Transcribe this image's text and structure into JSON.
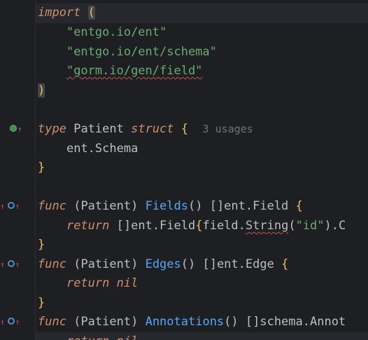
{
  "editor": {
    "lines": {
      "import_kw": "import",
      "import_paren": "(",
      "str1": "\"entgo.io/ent\"",
      "str2": "\"entgo.io/ent/schema\"",
      "str3": "\"gorm.io/gen/field\"",
      "close_paren": ")",
      "type_kw": "type",
      "type_name": "Patient",
      "struct_kw": "struct",
      "brace_open": "{",
      "usages_hint": "3 usages",
      "embed": "ent.Schema",
      "brace_close": "}",
      "func_kw": "func",
      "recv1": "(Patient)",
      "fields_fn": "Fields",
      "fields_sig": "() []ent.Field",
      "return_kw": "return",
      "fields_ret_a": "[]ent.Field",
      "fields_ret_b": "field.",
      "string_fn": "String",
      "fields_ret_c": "(",
      "id_str": "\"id\"",
      "fields_ret_d": ").C",
      "edges_fn": "Edges",
      "edges_sig": "() []ent.Edge",
      "nil_kw": "nil",
      "annot_fn": "Annotations",
      "annot_sig": "() []schema.Annot",
      "last_partial": "return nil"
    }
  },
  "gutter_icons": {
    "implemented": "implemented-icon",
    "overridden": "overridden-icon"
  },
  "colors": {
    "background": "#1e1f22",
    "keyword": "#cf8e6d",
    "string": "#6aab73",
    "function": "#56a8f5",
    "brace": "#e6c05b",
    "error_squiggle": "#c94f4f"
  }
}
